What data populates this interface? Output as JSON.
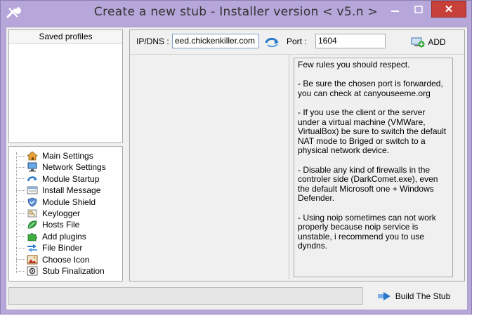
{
  "window": {
    "title": "Create a new stub - Installer version < v5.n >",
    "close_glyph": "✕",
    "min_glyph": "—",
    "max_glyph": "☐"
  },
  "saved_profiles": {
    "header": "Saved profiles"
  },
  "tree": {
    "items": [
      {
        "label": "Main Settings",
        "icon": "house-icon"
      },
      {
        "label": "Network Settings",
        "icon": "monitor-network-icon"
      },
      {
        "label": "Module Startup",
        "icon": "startup-arrow-icon"
      },
      {
        "label": "Install Message",
        "icon": "message-window-icon"
      },
      {
        "label": "Module Shield",
        "icon": "shield-icon"
      },
      {
        "label": "Keylogger",
        "icon": "key-icon"
      },
      {
        "label": "Hosts File",
        "icon": "leaf-icon"
      },
      {
        "label": "Add plugins",
        "icon": "puzzle-icon"
      },
      {
        "label": "File Binder",
        "icon": "binder-arrows-icon"
      },
      {
        "label": "Choose Icon",
        "icon": "picture-icon"
      },
      {
        "label": "Stub Finalization",
        "icon": "finalize-gear-icon"
      }
    ]
  },
  "connection": {
    "ip_label": "IP/DNS :",
    "ip_value": "eed.chickenkiller.com",
    "port_label": "Port :",
    "port_value": "1604",
    "add_label": "ADD"
  },
  "rules_text": "Few rules you should respect.\n\n- Be sure the chosen port is forwarded, you can check at canyouseeme.org\n\n- If you use the client or the server under a virtual machine (VMWare, VirtualBox) be sure to switch the default NAT mode to Briged or switch to a physical network device.\n\n- Disable any kind of firewalls in the controler side (DarkComet.exe), even the default Microsoft one + Windows Defender.\n\n- Using noip sometimes can not work properly because noip service is unstable, i recommend you to use dyndns.",
  "progress": {
    "value": 0
  },
  "build": {
    "label": "Build The Stub"
  },
  "colors": {
    "window_frame": "#b7a6d9",
    "close_button": "#c7403a",
    "progress_fill": "#06b025"
  }
}
